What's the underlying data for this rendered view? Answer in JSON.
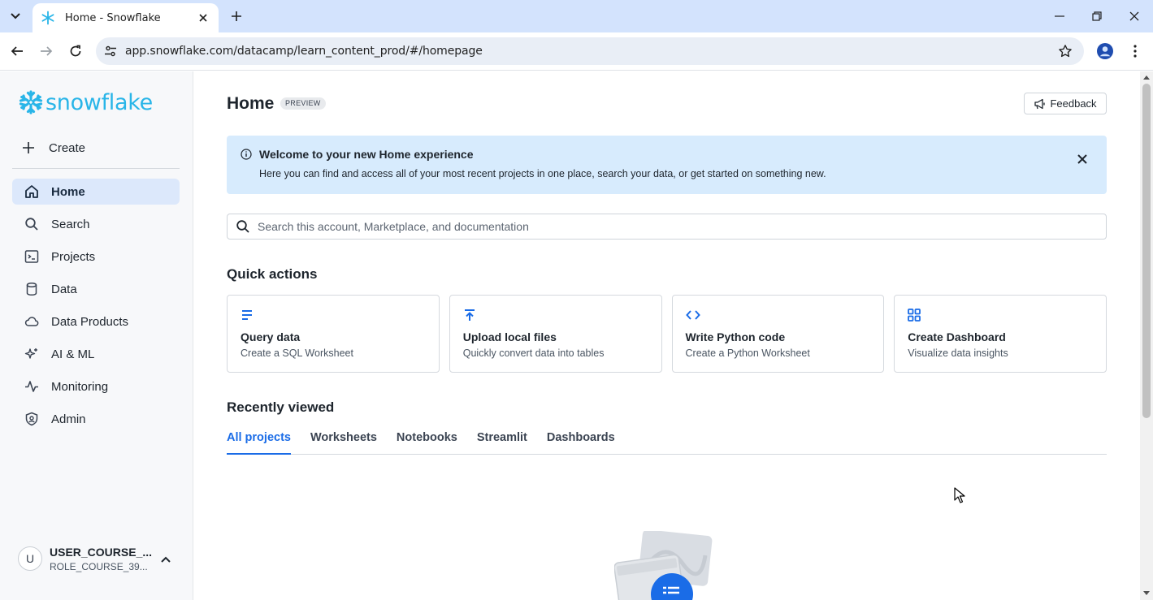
{
  "browser": {
    "tab_title": "Home - Snowflake",
    "url": "app.snowflake.com/datacamp/learn_content_prod/#/homepage"
  },
  "sidebar": {
    "logo_text": "snowflake",
    "create_label": "Create",
    "items": [
      {
        "label": "Home",
        "icon": "home-icon",
        "active": true
      },
      {
        "label": "Search",
        "icon": "search-icon"
      },
      {
        "label": "Projects",
        "icon": "terminal-icon"
      },
      {
        "label": "Data",
        "icon": "database-icon"
      },
      {
        "label": "Data Products",
        "icon": "cloud-icon"
      },
      {
        "label": "AI & ML",
        "icon": "sparkle-icon"
      },
      {
        "label": "Monitoring",
        "icon": "activity-icon"
      },
      {
        "label": "Admin",
        "icon": "shield-icon"
      }
    ],
    "user": {
      "initial": "U",
      "name": "USER_COURSE_...",
      "role": "ROLE_COURSE_39..."
    }
  },
  "header": {
    "title": "Home",
    "badge": "PREVIEW",
    "feedback_label": "Feedback"
  },
  "banner": {
    "title": "Welcome to your new Home experience",
    "text": "Here you can find and access all of your most recent projects in one place, search your data, or get started on something new."
  },
  "search": {
    "placeholder": "Search this account, Marketplace, and documentation"
  },
  "quick_actions": {
    "title": "Quick actions",
    "cards": [
      {
        "title": "Query data",
        "subtitle": "Create a SQL Worksheet",
        "icon": "lines-icon"
      },
      {
        "title": "Upload local files",
        "subtitle": "Quickly convert data into tables",
        "icon": "upload-icon"
      },
      {
        "title": "Write Python code",
        "subtitle": "Create a Python Worksheet",
        "icon": "code-icon"
      },
      {
        "title": "Create Dashboard",
        "subtitle": "Visualize data insights",
        "icon": "grid-icon"
      }
    ]
  },
  "recently_viewed": {
    "title": "Recently viewed",
    "tabs": [
      "All projects",
      "Worksheets",
      "Notebooks",
      "Streamlit",
      "Dashboards"
    ],
    "active_tab": "All projects"
  },
  "colors": {
    "accent": "#1a6ce7",
    "brand": "#29b5e8",
    "banner_bg": "#d7ebfd",
    "active_nav_bg": "#dce8fb"
  }
}
